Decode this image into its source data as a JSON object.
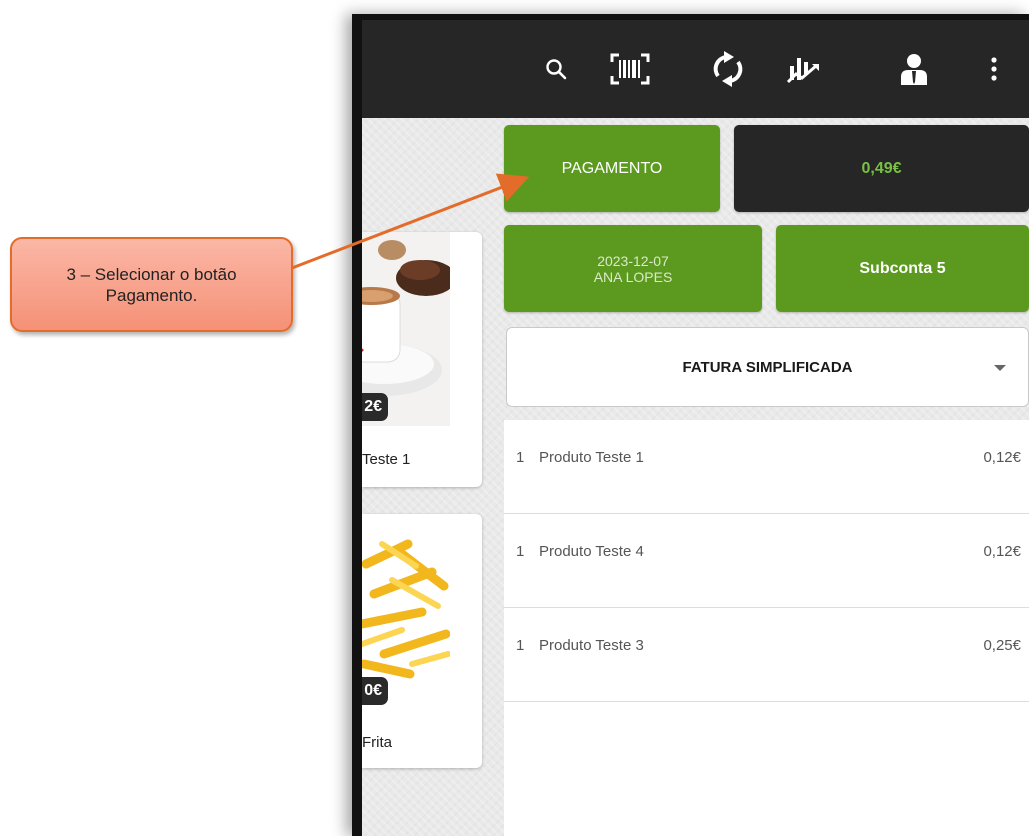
{
  "callout": {
    "line1": "3 – Selecionar o botão",
    "line2": "Pagamento."
  },
  "toolbar": {
    "icons": [
      "search-icon",
      "barcode-icon",
      "sync-icon",
      "stats-icon",
      "user-icon",
      "more-icon"
    ]
  },
  "products": [
    {
      "price": "2€",
      "name": "Teste 1",
      "image": "coffee-image"
    },
    {
      "price": "0€",
      "name": "Frita",
      "image": "fries-image"
    }
  ],
  "actions": {
    "payment_label": "PAGAMENTO",
    "total": "0,49€",
    "date": "2023-12-07",
    "operator": "ANA LOPES",
    "subaccount": "Subconta 5"
  },
  "document": {
    "type_selected": "FATURA SIMPLIFICADA"
  },
  "lines": [
    {
      "qty": "1",
      "name": "Produto Teste 1",
      "price": "0,12€"
    },
    {
      "qty": "1",
      "name": "Produto Teste 4",
      "price": "0,12€"
    },
    {
      "qty": "1",
      "name": "Produto Teste 3",
      "price": "0,25€"
    }
  ],
  "colors": {
    "accent_green": "#5b9a1f",
    "total_green": "#7ac143",
    "topbar": "#262626",
    "callout_border": "#e36c2a"
  }
}
